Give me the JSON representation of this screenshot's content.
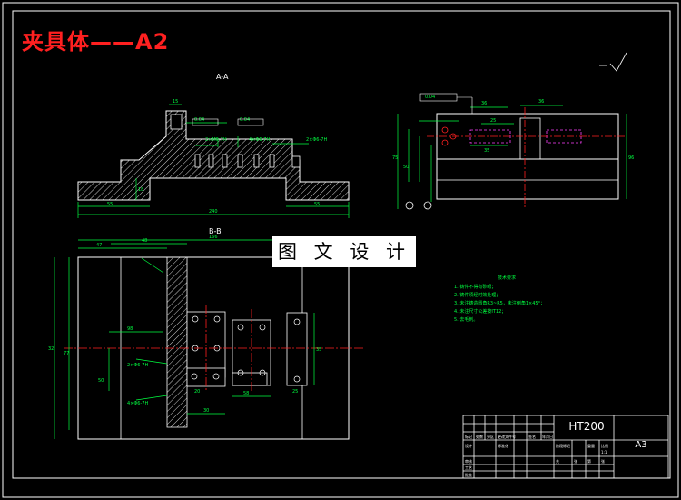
{
  "drawing": {
    "title": "夹具体——A2",
    "watermark": "图 文 设 计",
    "section_aa": "A-A",
    "section_bb": "B-B",
    "notes_heading": "技术要求",
    "notes": [
      "1. 铸件不得有砂眼；",
      "2. 铸件须经时效处理；",
      "3. 未注铸造圆角R3~R5，未注倒角1×45°；",
      "4. 未注尺寸公差按IT12；",
      "5. 去毛刺。"
    ],
    "title_block": {
      "material": "HT200",
      "part_name": "A3",
      "cells": [
        "标记",
        "处数",
        "分区",
        "更改文件号",
        "签名",
        "年月日",
        "设计",
        "标准化",
        "阶段标记",
        "重量",
        "比例",
        "审核",
        "工艺",
        "批准",
        "共",
        "张",
        "第",
        "张",
        "1:1"
      ]
    },
    "dims": {
      "aa": [
        "240",
        "55",
        "55",
        "18",
        "15",
        "25",
        "10",
        "8",
        "5"
      ],
      "top": [
        "36",
        "36",
        "96",
        "25",
        "35",
        "75",
        "50"
      ],
      "bb": [
        "47",
        "48",
        "166",
        "32",
        "77",
        "98",
        "30",
        "58",
        "35",
        "25",
        "20",
        "50"
      ],
      "callouts": [
        "2×M6-7H",
        "4×Φ6-7H",
        "2×Φ6-7H",
        "0.04",
        "0.04",
        "0.04"
      ]
    },
    "colors": {
      "background": "#000000",
      "line": "#ffffff",
      "title": "#ff2020",
      "dimension": "#00ff40",
      "center": "#ff2020",
      "hidden": "#ff40ff",
      "hatch": "#ffffff"
    }
  }
}
